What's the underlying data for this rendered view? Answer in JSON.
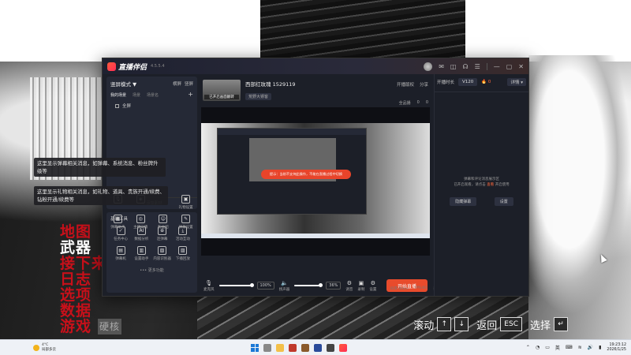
{
  "app": {
    "name": "直播伴侣",
    "version": "4.5.5.4"
  },
  "left": {
    "scene_mode": "竖屏模式 ▼",
    "actions": [
      "横屏",
      "竖屏"
    ],
    "tabs": [
      "我的场景",
      "场景",
      "场景名"
    ],
    "scene_item": "全屏",
    "add_source": "+ 添加素材",
    "tools_row1": [
      {
        "label": "",
        "icon": "mic-icon",
        "glyph": "🎙"
      },
      {
        "label": "",
        "icon": "shield-icon",
        "glyph": "◈"
      },
      {
        "label": "礼物设置",
        "icon": "gift-icon",
        "glyph": "▣"
      }
    ],
    "tools_row2": [
      {
        "label": "弹幕助手",
        "icon": "danmaku-icon",
        "glyph": "▦"
      },
      {
        "label": "主播口播",
        "icon": "voice-icon",
        "glyph": "◎"
      },
      {
        "label": "粉丝团",
        "icon": "fans-icon",
        "glyph": "☺"
      },
      {
        "label": "弹幕设置",
        "icon": "settings-icon",
        "glyph": "✎"
      }
    ],
    "basic_tools_title": "基础工具",
    "basic_tools": [
      {
        "label": "任务中心",
        "icon": "task-icon",
        "glyph": "✓"
      },
      {
        "label": "数据分析",
        "icon": "ai-icon",
        "glyph": "AI"
      },
      {
        "label": "连弹幕",
        "icon": "link-icon",
        "glyph": "⊕"
      },
      {
        "label": "活动互动",
        "icon": "download-icon",
        "glyph": "⤓"
      },
      {
        "label": "弹幕机",
        "icon": "screen-icon",
        "glyph": "▤"
      },
      {
        "label": "设置助手",
        "icon": "chart-icon",
        "glyph": "▥"
      },
      {
        "label": "内容识别器",
        "icon": "scan-icon",
        "glyph": "▧"
      },
      {
        "label": "下播回放",
        "icon": "replay-icon",
        "glyph": "▨"
      }
    ],
    "more": "••• 更多功能"
  },
  "room": {
    "thumb_label": "已开启画面翻转",
    "title": "西部红玫瑰 1529119",
    "category": "荒野大镖客",
    "top_right": [
      "开播版权",
      "分享"
    ],
    "stats": [
      "全品播",
      "0",
      "0"
    ]
  },
  "preview": {
    "toast": "提示：当前不支持此操作，不能在直播过程中切换"
  },
  "controls": {
    "mic_label": "麦克风",
    "mic_pct": "100%",
    "speaker_label": "扬声器",
    "speaker_pct": "36%",
    "ctrl1": "调音",
    "ctrl2": "录制",
    "ctrl3": "设置",
    "start": "开始直播"
  },
  "status": [
    "码率:0kb/s",
    "FPS:60",
    "丢帧:0(0.00%)",
    "CPU:10%",
    "内存:14%",
    "网络:良好"
  ],
  "right": {
    "tab1": "开播时长",
    "tab2": "V120",
    "tab3": "🔥 0",
    "more": "详情 ▾",
    "msg_line1": "弹幕和评论消息展示区",
    "msg_line2": "已开启观看，请点击",
    "msg_link": "查看",
    "msg_end": "开启使用",
    "btn1": "隐藏弹幕",
    "btn2": "设置"
  },
  "tooltips": {
    "tip1": "这里显示弹幕相关消息，如弹幕、系统消息、粉丝牌升级等",
    "tip2": "这里显示礼物相关消息，如礼物、道具、贵族开通/续费、钻粉开通/续费等"
  },
  "game_menu": {
    "row1": "地图",
    "row2": "武器",
    "row3": "接下来",
    "row4": "日志",
    "row5": "选项",
    "row6": "数据",
    "row7": "游戏",
    "row7_small": "硬核"
  },
  "game_hints": {
    "scroll": "滚动",
    "back": "返回",
    "back_key": "ESC",
    "select": "选择",
    "select_key": "↵"
  },
  "taskbar": {
    "temp": "4°C",
    "weather": "局部多云",
    "lang": "英",
    "time": "19:23:12",
    "date": "2026/1/25"
  }
}
